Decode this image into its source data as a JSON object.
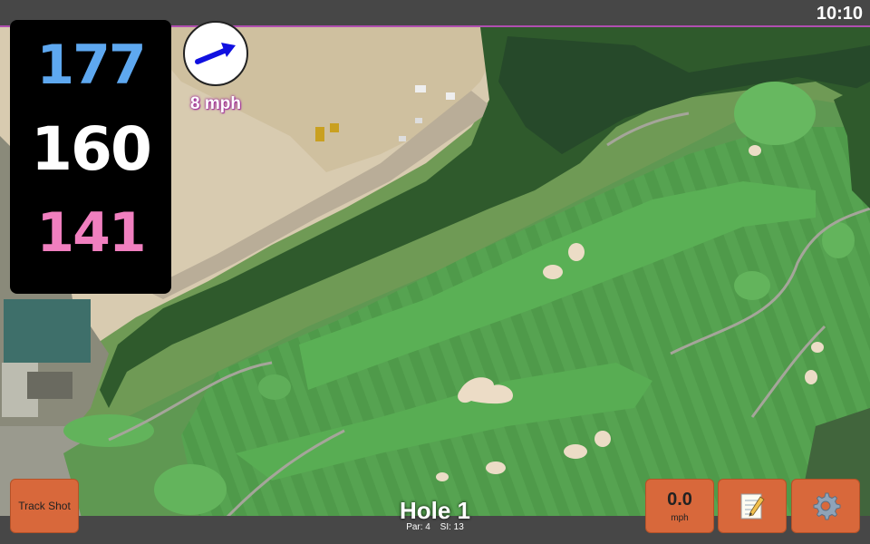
{
  "status": {
    "time": "10:10"
  },
  "distances": {
    "back": "177",
    "middle": "160",
    "front": "141"
  },
  "distance_colors": {
    "back": "#5ea8f0",
    "middle": "#ffffff",
    "front": "#f07fbf"
  },
  "wind": {
    "speed": "8 mph",
    "icon": "wind-direction-arrow-icon",
    "arrow_color": "#1010e0"
  },
  "buttons": {
    "track_shot": "Track Shot",
    "speed_value": "0.0",
    "speed_unit": "mph",
    "notes_icon": "notepad-icon",
    "settings_icon": "gear-icon"
  },
  "hole": {
    "title": "Hole 1",
    "par": "Par: 4",
    "si": "SI: 13"
  },
  "colors": {
    "accent": "#d8683b",
    "map_border": "#b04fb0"
  }
}
